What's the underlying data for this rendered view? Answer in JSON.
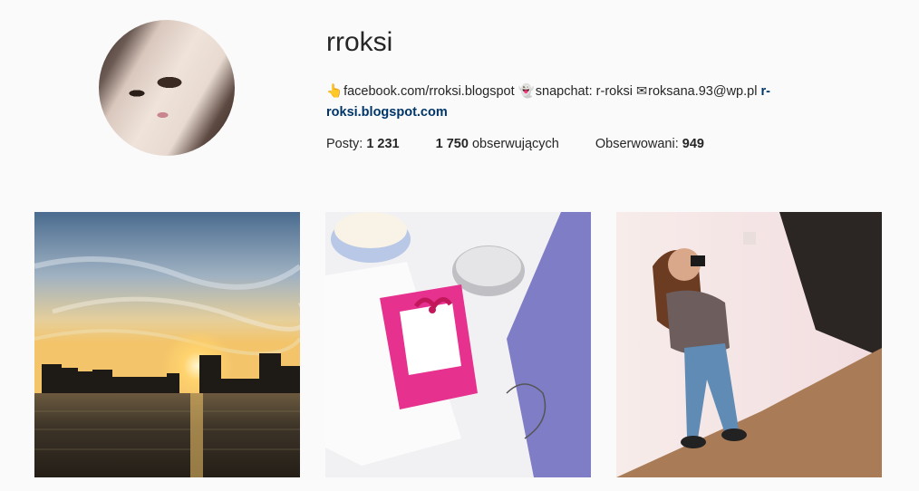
{
  "profile": {
    "username": "rroksi",
    "bio": {
      "icon1": "👆",
      "facebook": "facebook.com/rroksi.blogspot",
      "icon2": "👻",
      "snapchat": "snapchat: r-roksi",
      "icon3": "✉",
      "email": "roksana.93@wp.pl",
      "link": "r-roksi.blogspot.com"
    },
    "stats": {
      "posts_label": "Posty: ",
      "posts_value": "1 231",
      "followers_value": "1 750",
      "followers_label": " obserwujących",
      "following_label": "Obserwowani: ",
      "following_value": "949"
    }
  },
  "posts": [
    {
      "name": "post-sunset"
    },
    {
      "name": "post-candle-gift"
    },
    {
      "name": "post-mirror-selfie"
    }
  ],
  "colors": {
    "background": "#fafafa",
    "text": "#262626",
    "link": "#003569"
  }
}
